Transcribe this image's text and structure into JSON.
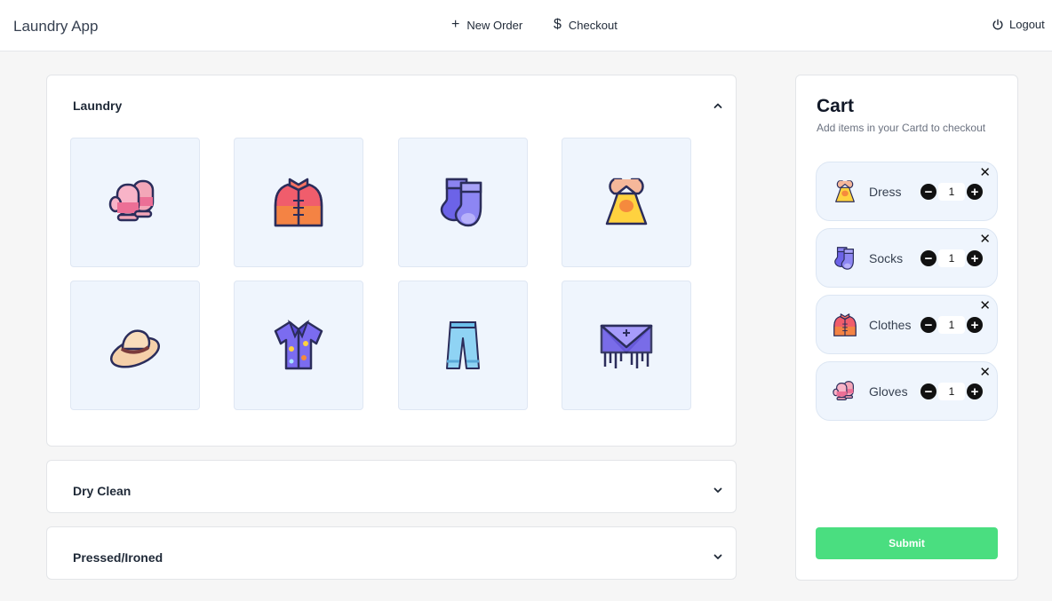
{
  "header": {
    "brand": "Laundry App",
    "new_order": "New Order",
    "checkout": "Checkout",
    "logout": "Logout"
  },
  "sections": [
    {
      "title": "Laundry",
      "expanded": true
    },
    {
      "title": "Dry Clean",
      "expanded": false
    },
    {
      "title": "Pressed/Ironed",
      "expanded": false
    }
  ],
  "laundry_items": [
    "gloves-icon",
    "clothes-icon",
    "socks-icon",
    "dress-icon",
    "hat-icon",
    "shirt-icon",
    "jeans-icon",
    "shawl-icon"
  ],
  "cart": {
    "title": "Cart",
    "subtitle": "Add items in your Cartd to checkout",
    "items": [
      {
        "name": "Dress",
        "qty": "1",
        "icon": "dress-icon"
      },
      {
        "name": "Socks",
        "qty": "1",
        "icon": "socks-icon"
      },
      {
        "name": "Clothes",
        "qty": "1",
        "icon": "clothes-icon"
      },
      {
        "name": "Gloves",
        "qty": "1",
        "icon": "gloves-icon"
      }
    ],
    "submit": "Submit"
  },
  "colors": {
    "accent_green": "#4ade80",
    "tile_bg": "#eff5fd",
    "page_bg": "#f6f6f6"
  }
}
